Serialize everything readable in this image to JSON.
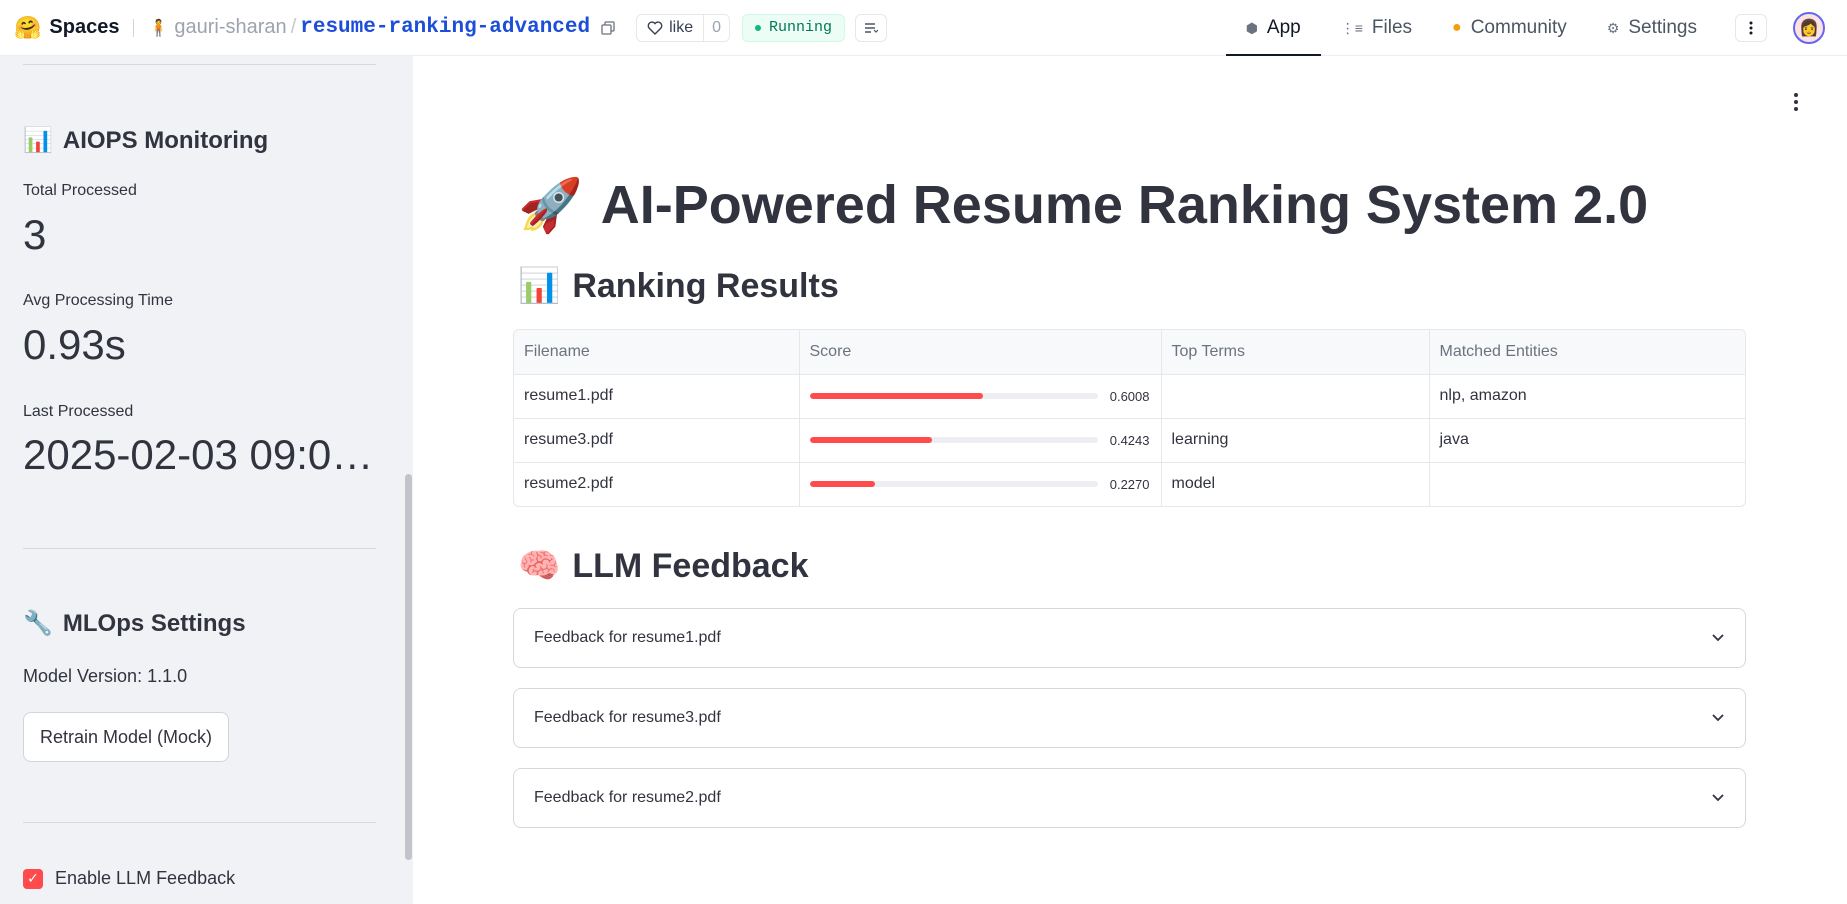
{
  "header": {
    "brand": "Spaces",
    "owner": "gauri-sharan",
    "separator": "/",
    "repo": "resume-ranking-advanced",
    "like_label": "like",
    "like_count": "0",
    "status": "Running",
    "tabs": [
      {
        "label": "App",
        "icon": "cube-icon"
      },
      {
        "label": "Files",
        "icon": "files-icon"
      },
      {
        "label": "Community",
        "icon": "community-icon"
      },
      {
        "label": "Settings",
        "icon": "gear-icon"
      }
    ]
  },
  "sidebar": {
    "aiops_title": "AIOPS Monitoring",
    "metrics": [
      {
        "label": "Total Processed",
        "value": "3"
      },
      {
        "label": "Avg Processing Time",
        "value": "0.93s"
      },
      {
        "label": "Last Processed",
        "value": "2025-02-03 09:0…"
      }
    ],
    "mlops_title": "MLOps Settings",
    "model_version": "Model Version: 1.1.0",
    "retrain_label": "Retrain Model (Mock)",
    "llm_checkbox_label": "Enable LLM Feedback",
    "llm_checkbox_checked": true
  },
  "main": {
    "title": "AI-Powered Resume Ranking System 2.0",
    "results_heading": "Ranking Results",
    "table": {
      "columns": [
        "Filename",
        "Score",
        "Top Terms",
        "Matched Entities"
      ],
      "rows": [
        {
          "filename": "resume1.pdf",
          "score": 0.6008,
          "score_text": "0.6008",
          "top_terms": "",
          "entities": "nlp, amazon"
        },
        {
          "filename": "resume3.pdf",
          "score": 0.4243,
          "score_text": "0.4243",
          "top_terms": "learning",
          "entities": "java"
        },
        {
          "filename": "resume2.pdf",
          "score": 0.227,
          "score_text": "0.2270",
          "top_terms": "model",
          "entities": ""
        }
      ]
    },
    "feedback_heading": "LLM Feedback",
    "feedback_items": [
      "Feedback for resume1.pdf",
      "Feedback for resume3.pdf",
      "Feedback for resume2.pdf"
    ]
  },
  "colors": {
    "accent": "#ff4b4b",
    "sidebar_bg": "#f0f2f6",
    "link": "#1d4ed8",
    "running": "#047857"
  }
}
